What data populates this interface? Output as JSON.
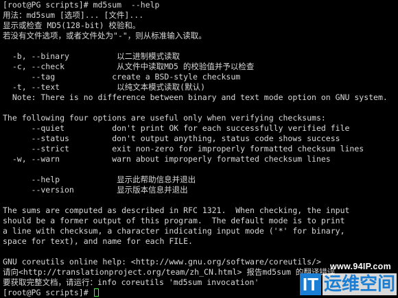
{
  "terminal": {
    "lines": [
      "[root@PG scripts]# md5sum  --help",
      "用法：md5sum [选项]... [文件]...",
      "显示或检查 MD5(128-bit) 校验和。",
      "若没有文件选项，或者文件处为\"-\"，则从标准输入读取。",
      "",
      "  -b, --binary          以二进制模式读取",
      "  -c, --check           从文件中读取MD5 的校验值并予以检查",
      "      --tag            create a BSD-style checksum",
      "  -t, --text            以纯文本模式读取(默认)",
      "  Note: There is no difference between binary and text mode option on GNU system.",
      "",
      "The following four options are useful only when verifying checksums:",
      "      --quiet          don't print OK for each successfully verified file",
      "      --status         don't output anything, status code shows success",
      "      --strict         exit non-zero for improperly formatted checksum lines",
      "  -w, --warn           warn about improperly formatted checksum lines",
      "",
      "      --help            显示此帮助信息并退出",
      "      --version         显示版本信息并退出",
      "",
      "The sums are computed as described in RFC 1321.  When checking, the input",
      "should be a former output of this program.  The default mode is to print",
      "a line with checksum, a character indicating input mode ('*' for binary,",
      "space for text), and name for each FILE.",
      "",
      "GNU coreutils online help: <http://www.gnu.org/software/coreutils/>",
      "请向<http://translationproject.org/team/zh_CN.html> 报告md5sum 的翻译错误",
      "要获取完整文档，请运行：info coreutils 'md5sum invocation'"
    ],
    "prompt": "[root@PG scripts]# "
  },
  "watermark": {
    "url": "www.94IP.com",
    "logo_it": "IT",
    "logo_text": "运维空间",
    "brand_color": "#1a7fd4"
  },
  "colors": {
    "background": "#000000",
    "foreground": "#d9d9d9",
    "cursor": "#3cff3c"
  }
}
